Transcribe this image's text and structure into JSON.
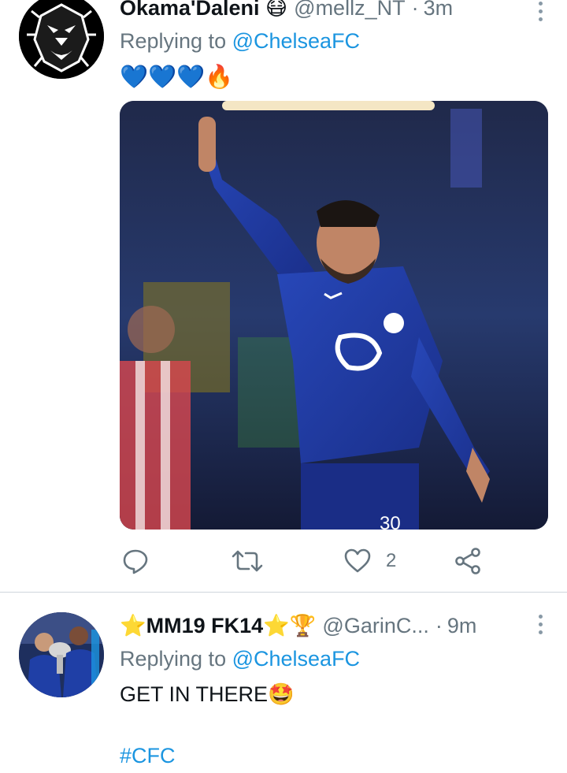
{
  "tweets": [
    {
      "display_name": "Okama'Daleni 😷",
      "handle": "@mellz_NT",
      "separator": "·",
      "time": "3m",
      "replying_prefix": "Replying to ",
      "replying_to": "@ChelseaFC",
      "text": "💙💙💙🔥",
      "actions": {
        "like_count": "2"
      },
      "icons": {
        "more": "more-vertical-icon",
        "reply": "reply-icon",
        "retweet": "retweet-icon",
        "like": "heart-icon",
        "share": "share-icon"
      }
    },
    {
      "display_name": "⭐MM19 FK14⭐🏆",
      "handle": "@GarinC...",
      "separator": "·",
      "time": "9m",
      "replying_prefix": "Replying to ",
      "replying_to": "@ChelseaFC",
      "text": "GET IN THERE🤩",
      "hashtag": "#CFC",
      "icons": {
        "more": "more-vertical-icon"
      }
    }
  ],
  "colors": {
    "link": "#1b95e0",
    "secondary_text": "#66757f",
    "divider": "#cfd6dc",
    "player_kit": "#1f3fa6"
  }
}
